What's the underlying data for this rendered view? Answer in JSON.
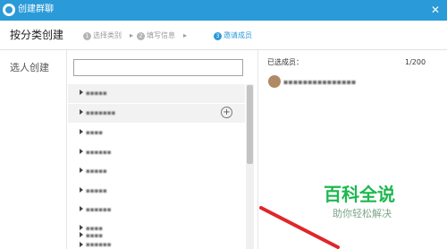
{
  "window": {
    "title": "创建群聊",
    "close_glyph": "✕"
  },
  "steps": {
    "title": "按分类创建",
    "items": [
      {
        "num": "1",
        "label": "选择类别"
      },
      {
        "num": "2",
        "label": "填写信息"
      },
      {
        "num": "3",
        "label": "邀请成员"
      }
    ],
    "arrow_glyph": "▸"
  },
  "left": {
    "label": "选人创建",
    "search_value": ""
  },
  "tree": {
    "add_glyph": "+",
    "rows": [
      {
        "label": "▪▪▪▪▪"
      },
      {
        "label": "▪▪▪▪▪▪▪"
      },
      {
        "label": "▪▪▪▪"
      },
      {
        "label": "▪▪▪▪▪▪"
      },
      {
        "label": "▪▪▪▪▪"
      },
      {
        "label": "▪▪▪▪▪"
      },
      {
        "label": "▪▪▪▪▪▪"
      },
      {
        "label": "▪▪▪▪"
      },
      {
        "label": "▪▪▪▪"
      },
      {
        "label": "▪▪▪▪▪▪"
      }
    ]
  },
  "selected": {
    "label": "已选成员：",
    "count": "1/200",
    "members": [
      {
        "name": "▪▪▪▪▪▪▪▪▪▪▪▪▪▪▪"
      }
    ]
  },
  "watermark": {
    "title": "百科全说",
    "subtitle": "助你轻松解决"
  },
  "colors": {
    "titlebar": "#2a9ad8",
    "active_step": "#2a9ad8",
    "watermark": "#1db84f",
    "annotation_arrow": "#e0262a"
  }
}
